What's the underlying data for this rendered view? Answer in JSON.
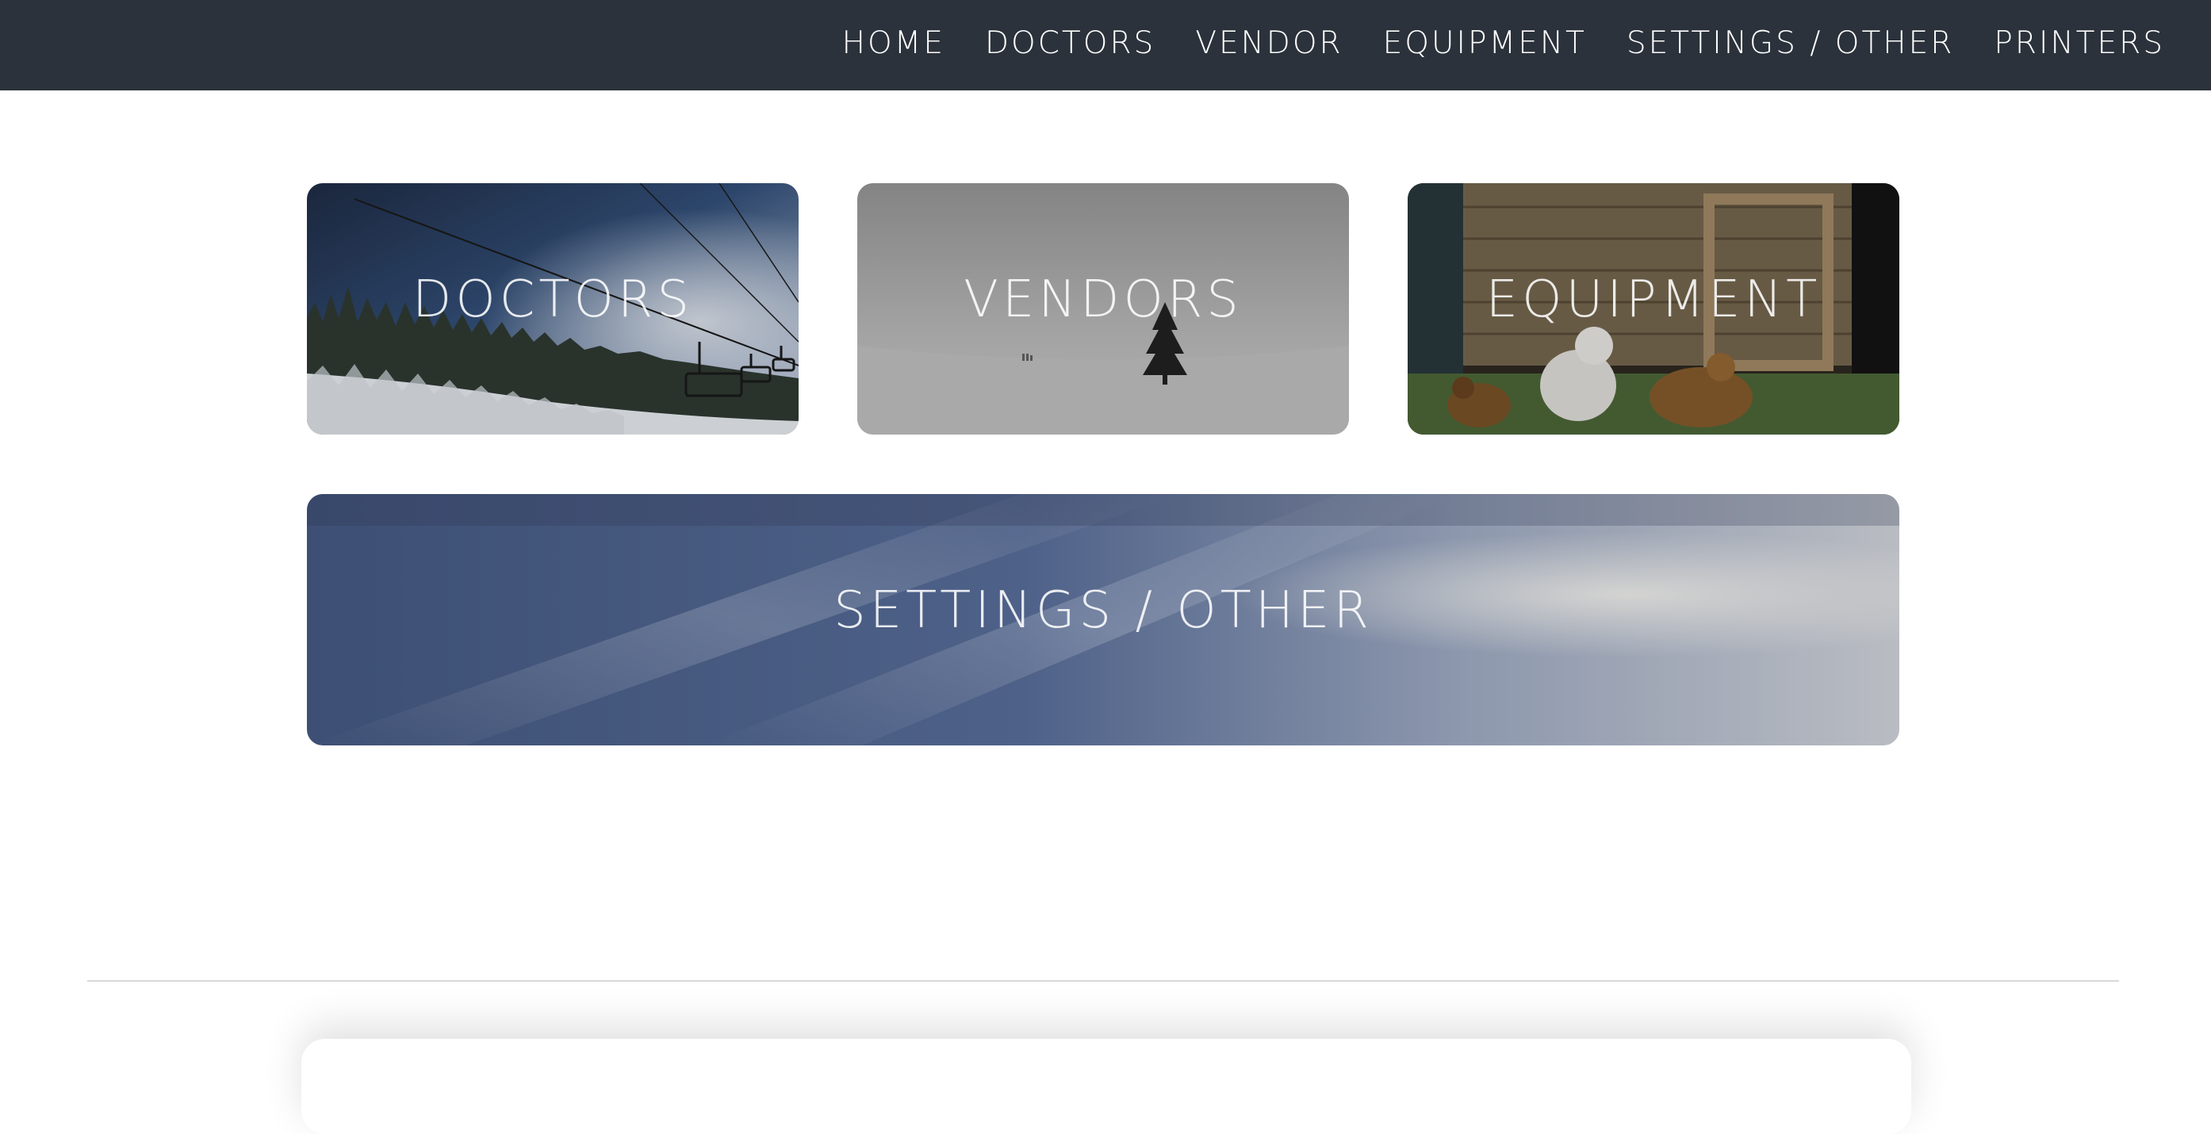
{
  "nav": {
    "items": [
      {
        "label": "HOME"
      },
      {
        "label": "DOCTORS"
      },
      {
        "label": "VENDOR"
      },
      {
        "label": "EQUIPMENT"
      },
      {
        "label": "SETTINGS / OTHER"
      },
      {
        "label": "PRINTERS"
      }
    ]
  },
  "tiles": {
    "doctors": {
      "label": "DOCTORS",
      "image": "ski-lift-snow-forest"
    },
    "vendors": {
      "label": "VENDORS",
      "image": "lone-tree-snowfield"
    },
    "equipment": {
      "label": "EQUIPMENT",
      "image": "chickens-coop"
    },
    "settings": {
      "label": "SETTINGS / OTHER",
      "image": "cloudy-sky"
    }
  },
  "colors": {
    "topbar": "#2c323b",
    "background": "#ffffff",
    "divider": "#d9d9d9"
  }
}
